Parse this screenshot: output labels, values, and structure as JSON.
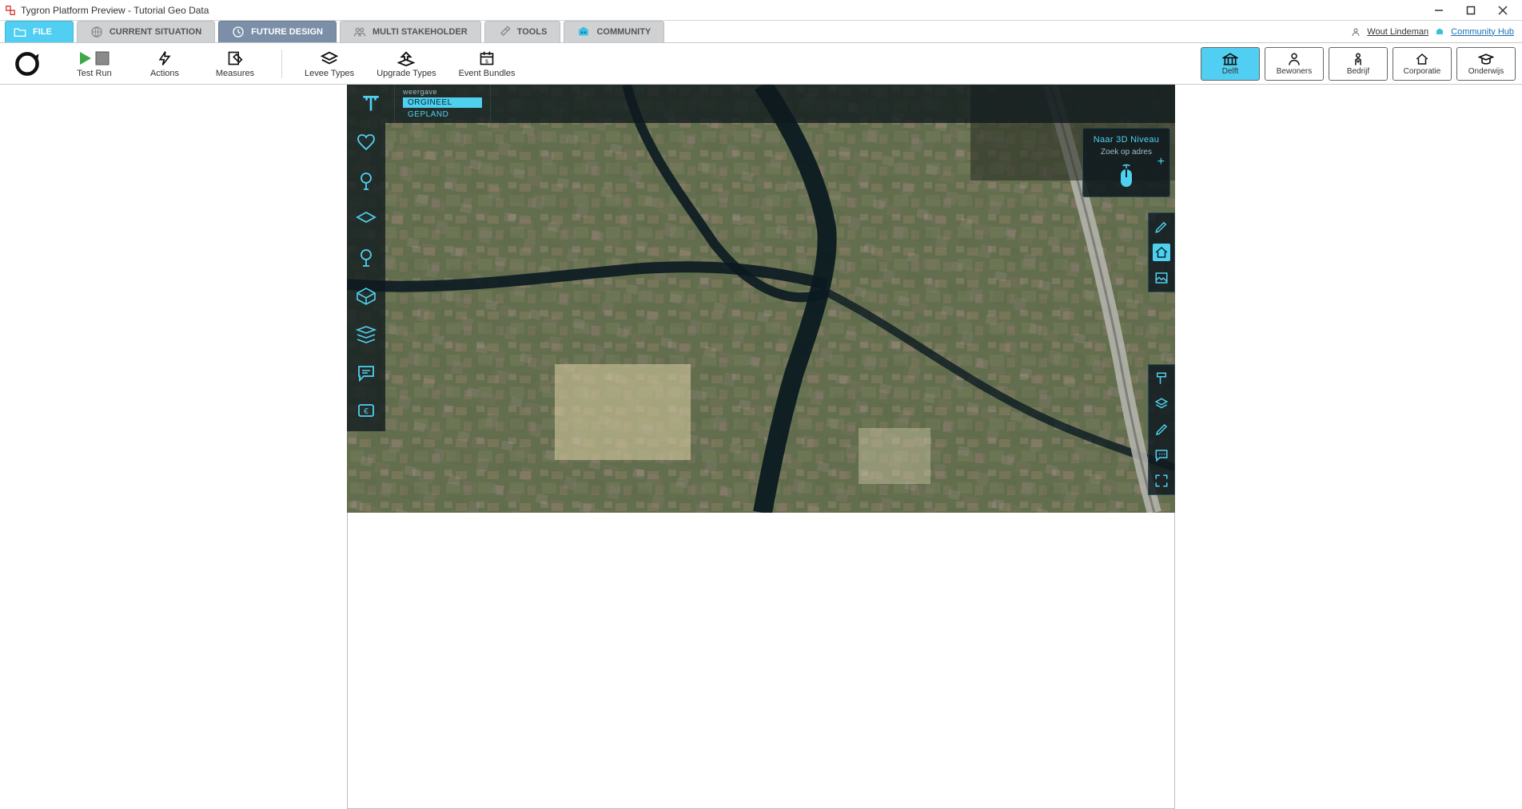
{
  "window": {
    "title": "Tygron Platform Preview - Tutorial Geo Data"
  },
  "ribbon": {
    "tabs": [
      {
        "id": "file",
        "label": "FILE"
      },
      {
        "id": "current",
        "label": "CURRENT SITUATION"
      },
      {
        "id": "future",
        "label": "FUTURE DESIGN"
      },
      {
        "id": "multi",
        "label": "MULTI STAKEHOLDER"
      },
      {
        "id": "tools",
        "label": "TOOLS"
      },
      {
        "id": "community",
        "label": "COMMUNITY"
      }
    ],
    "selected": "future",
    "user": {
      "name": "Wout Lindeman",
      "community_link": "Community Hub"
    }
  },
  "ribbon_panel": {
    "groups": [
      {
        "id": "testrun",
        "label": "Test Run"
      },
      {
        "id": "actions",
        "label": "Actions"
      },
      {
        "id": "measures",
        "label": "Measures"
      },
      {
        "id": "leveetypes",
        "label": "Levee Types"
      },
      {
        "id": "upgradetypes",
        "label": "Upgrade Types"
      },
      {
        "id": "eventbundles",
        "label": "Event Bundles"
      }
    ],
    "stakeholders": [
      {
        "id": "delft",
        "label": "Delft",
        "active": true
      },
      {
        "id": "bewoners",
        "label": "Bewoners"
      },
      {
        "id": "bedrijf",
        "label": "Bedrijf"
      },
      {
        "id": "corporatie",
        "label": "Corporatie"
      },
      {
        "id": "onderwijs",
        "label": "Onderwijs"
      }
    ]
  },
  "map": {
    "weergave_title": "weergave",
    "view_original": "ORGINEEL",
    "view_planned": "GEPLAND",
    "floating": {
      "to_3d": "Naar 3D Niveau",
      "search": "Zoek op adres"
    }
  },
  "colors": {
    "accent": "#4fd0ef",
    "file_tab": "#51cff2",
    "selected_tab": "#7b8fa8"
  }
}
